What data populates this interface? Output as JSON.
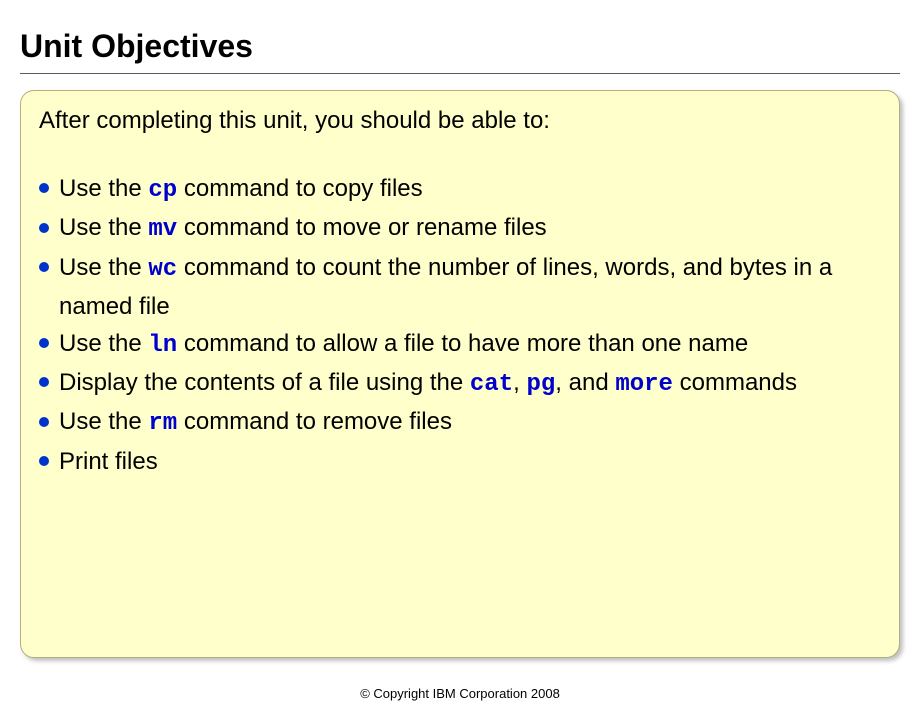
{
  "title": "Unit Objectives",
  "intro": "After completing this unit, you should be able to:",
  "bullets": {
    "b1": {
      "pre": "Use the ",
      "cmd": "cp",
      "post": " command to copy files"
    },
    "b2": {
      "pre": "Use the ",
      "cmd": "mv",
      "post": " command to move or rename files"
    },
    "b3": {
      "pre": "Use the ",
      "cmd": "wc",
      "post": " command to count the number of lines, words, and bytes in a named file"
    },
    "b4": {
      "pre": "Use the ",
      "cmd": "ln",
      "post": " command to allow a file to have more than one name"
    },
    "b5": {
      "pre": "Display the contents of a file using the ",
      "c1": "cat",
      "sep1": ", ",
      "c2": "pg",
      "sep2": ", and ",
      "c3": "more",
      "post": " commands"
    },
    "b6": {
      "pre": "Use the ",
      "cmd": "rm",
      "post": " command to remove files"
    },
    "b7": {
      "text": "Print files"
    }
  },
  "copyright": "© Copyright IBM Corporation 2008"
}
